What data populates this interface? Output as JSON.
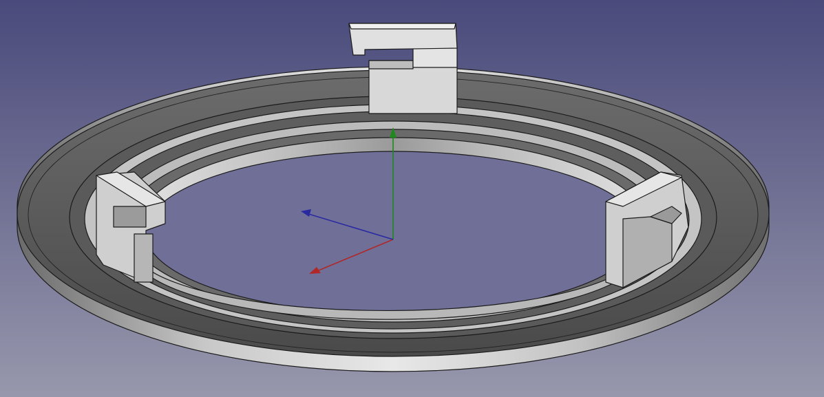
{
  "viewport": {
    "background": {
      "top_color": "#4a4a7c",
      "bottom_color": "#9797ac"
    },
    "model": {
      "shape": "ring-with-three-clips",
      "face_color": "#c9c9c9",
      "shadow_color": "#555555",
      "edge_color": "#1a1a1a"
    },
    "axis_cross": {
      "x_color": "#b02828",
      "y_color": "#1e8a1e",
      "z_color": "#2a2aa0"
    }
  }
}
